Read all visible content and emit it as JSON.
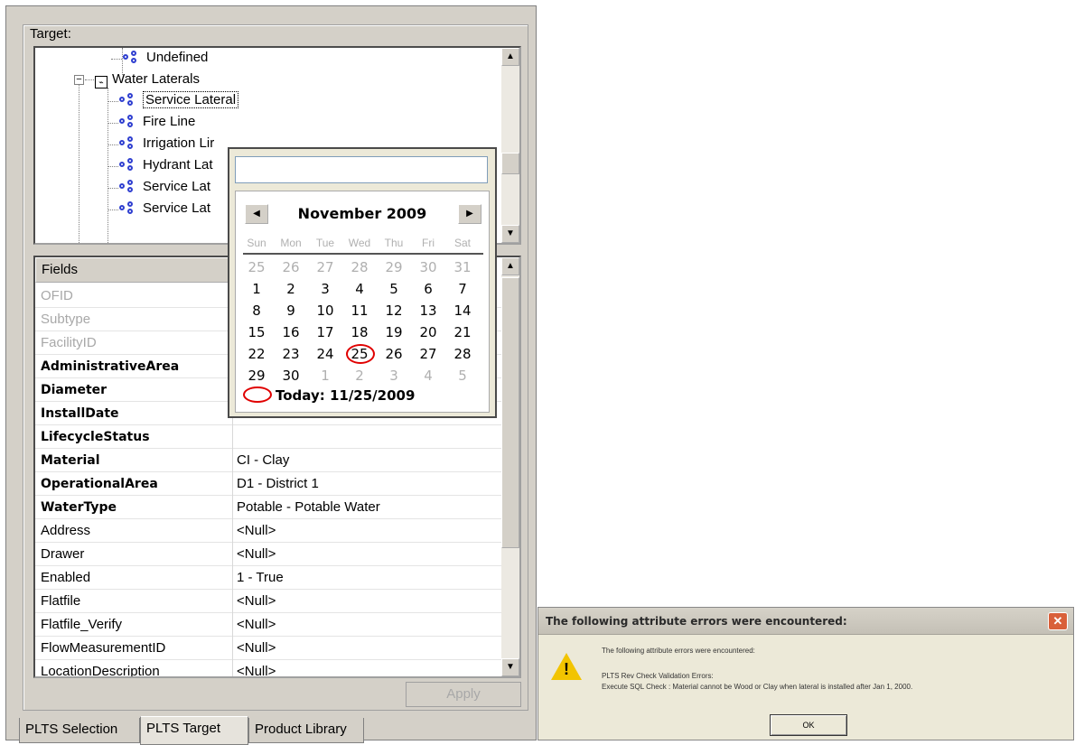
{
  "panel": {
    "target_label": "Target:",
    "tree": {
      "items": [
        {
          "label": "Undefined",
          "type": "subtype"
        },
        {
          "label": "Water Laterals",
          "type": "feature-class"
        },
        {
          "label": "Service Lateral",
          "type": "subtype",
          "selected": true
        },
        {
          "label": "Fire Line",
          "type": "subtype"
        },
        {
          "label": "Irrigation Lir",
          "type": "subtype"
        },
        {
          "label": "Hydrant Lat",
          "type": "subtype"
        },
        {
          "label": "Service Lat",
          "type": "subtype"
        },
        {
          "label": "Service Lat",
          "type": "subtype"
        }
      ]
    },
    "grid": {
      "header": "Fields",
      "rows": [
        {
          "name": "OFID",
          "value": "",
          "style": "readonly"
        },
        {
          "name": "Subtype",
          "value": "",
          "style": "readonly"
        },
        {
          "name": "FacilityID",
          "value": "",
          "style": "readonly"
        },
        {
          "name": "AdministrativeArea",
          "value": "",
          "style": "required"
        },
        {
          "name": "Diameter",
          "value": "",
          "style": "required"
        },
        {
          "name": "InstallDate",
          "value": "",
          "style": "required"
        },
        {
          "name": "LifecycleStatus",
          "value": "",
          "style": "required"
        },
        {
          "name": "Material",
          "value": "CI - Clay",
          "style": "required"
        },
        {
          "name": "OperationalArea",
          "value": "D1 - District 1",
          "style": "required"
        },
        {
          "name": "WaterType",
          "value": "Potable - Potable Water",
          "style": "required"
        },
        {
          "name": "Address",
          "value": "<Null>",
          "style": "normal"
        },
        {
          "name": "Drawer",
          "value": "<Null>",
          "style": "normal"
        },
        {
          "name": "Enabled",
          "value": "1 - True",
          "style": "normal"
        },
        {
          "name": "Flatfile",
          "value": "<Null>",
          "style": "normal"
        },
        {
          "name": "Flatfile_Verify",
          "value": "<Null>",
          "style": "normal"
        },
        {
          "name": "FlowMeasurementID",
          "value": "<Null>",
          "style": "normal"
        },
        {
          "name": "LocationDescription",
          "value": "<Null>",
          "style": "normal"
        }
      ]
    },
    "apply_label": "Apply",
    "tabs": [
      {
        "label": "PLTS Selection",
        "active": false
      },
      {
        "label": "PLTS Target",
        "active": true
      },
      {
        "label": "Product Library",
        "active": false
      }
    ]
  },
  "date_picker": {
    "input_value": "",
    "month_year": "November 2009",
    "weekdays": [
      "Sun",
      "Mon",
      "Tue",
      "Wed",
      "Thu",
      "Fri",
      "Sat"
    ],
    "weeks": [
      [
        {
          "d": "25",
          "o": true
        },
        {
          "d": "26",
          "o": true
        },
        {
          "d": "27",
          "o": true
        },
        {
          "d": "28",
          "o": true
        },
        {
          "d": "29",
          "o": true
        },
        {
          "d": "30",
          "o": true
        },
        {
          "d": "31",
          "o": true
        }
      ],
      [
        {
          "d": "1"
        },
        {
          "d": "2"
        },
        {
          "d": "3"
        },
        {
          "d": "4"
        },
        {
          "d": "5"
        },
        {
          "d": "6"
        },
        {
          "d": "7"
        }
      ],
      [
        {
          "d": "8"
        },
        {
          "d": "9"
        },
        {
          "d": "10"
        },
        {
          "d": "11"
        },
        {
          "d": "12"
        },
        {
          "d": "13"
        },
        {
          "d": "14"
        }
      ],
      [
        {
          "d": "15"
        },
        {
          "d": "16"
        },
        {
          "d": "17"
        },
        {
          "d": "18"
        },
        {
          "d": "19"
        },
        {
          "d": "20"
        },
        {
          "d": "21"
        }
      ],
      [
        {
          "d": "22"
        },
        {
          "d": "23"
        },
        {
          "d": "24"
        },
        {
          "d": "25",
          "today": true
        },
        {
          "d": "26"
        },
        {
          "d": "27"
        },
        {
          "d": "28"
        }
      ],
      [
        {
          "d": "29"
        },
        {
          "d": "30"
        },
        {
          "d": "1",
          "o": true
        },
        {
          "d": "2",
          "o": true
        },
        {
          "d": "3",
          "o": true
        },
        {
          "d": "4",
          "o": true
        },
        {
          "d": "5",
          "o": true
        }
      ]
    ],
    "today_label": "Today: 11/25/2009",
    "prev_icon": "left-arrow-icon",
    "next_icon": "right-arrow-icon",
    "today_color": "#e00000"
  },
  "dialog": {
    "title": "The following attribute errors were encountered:",
    "message1": "The following attribute errors were encountered:",
    "message2": "PLTS Rev Check Validation Errors:",
    "message3": "Execute SQL Check : Material cannot be Wood or Clay when lateral is installed after Jan 1, 2000.",
    "ok_label": "OK",
    "close_icon": "close-icon",
    "warning_icon": "warning-icon",
    "close_color": "#d9603a",
    "warning_color": "#f2c400"
  }
}
